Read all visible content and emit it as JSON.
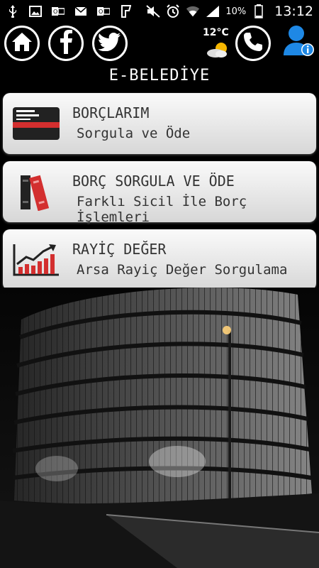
{
  "status_bar": {
    "left_icons": [
      "usb-icon",
      "image-icon",
      "outlook-icon",
      "mail-icon",
      "outlook-icon",
      "foursquare-icon"
    ],
    "right_icons": [
      "mute-icon",
      "alarm-icon",
      "wifi-icon",
      "signal-icon"
    ],
    "battery": "10%",
    "time": "13:12"
  },
  "header": {
    "home_icon": "home-icon",
    "facebook_icon": "facebook-icon",
    "twitter_icon": "twitter-icon",
    "weather_temp": "12°C",
    "weather_icon": "partly-cloudy-icon",
    "phone_icon": "phone-icon",
    "profile_icon": "user-info-icon"
  },
  "app_title": "E-BELEDİYE",
  "menu": [
    {
      "title": "BORÇLARIM",
      "subtitle": "Sorgula ve Öde",
      "icon": "credit-card-icon"
    },
    {
      "title": "BORÇ SORGULA VE ÖDE",
      "subtitle": "Farklı Sicil İle Borç İşlemleri",
      "icon": "books-icon"
    },
    {
      "title": "RAYİÇ DEĞER",
      "subtitle": "Arsa Rayiç Değer Sorgulama",
      "icon": "bar-chart-icon"
    }
  ],
  "colors": {
    "card_bg": "#eeeeee",
    "card_text": "#333333",
    "accent_red": "#d32f2f",
    "profile_blue": "#1e88e5"
  }
}
